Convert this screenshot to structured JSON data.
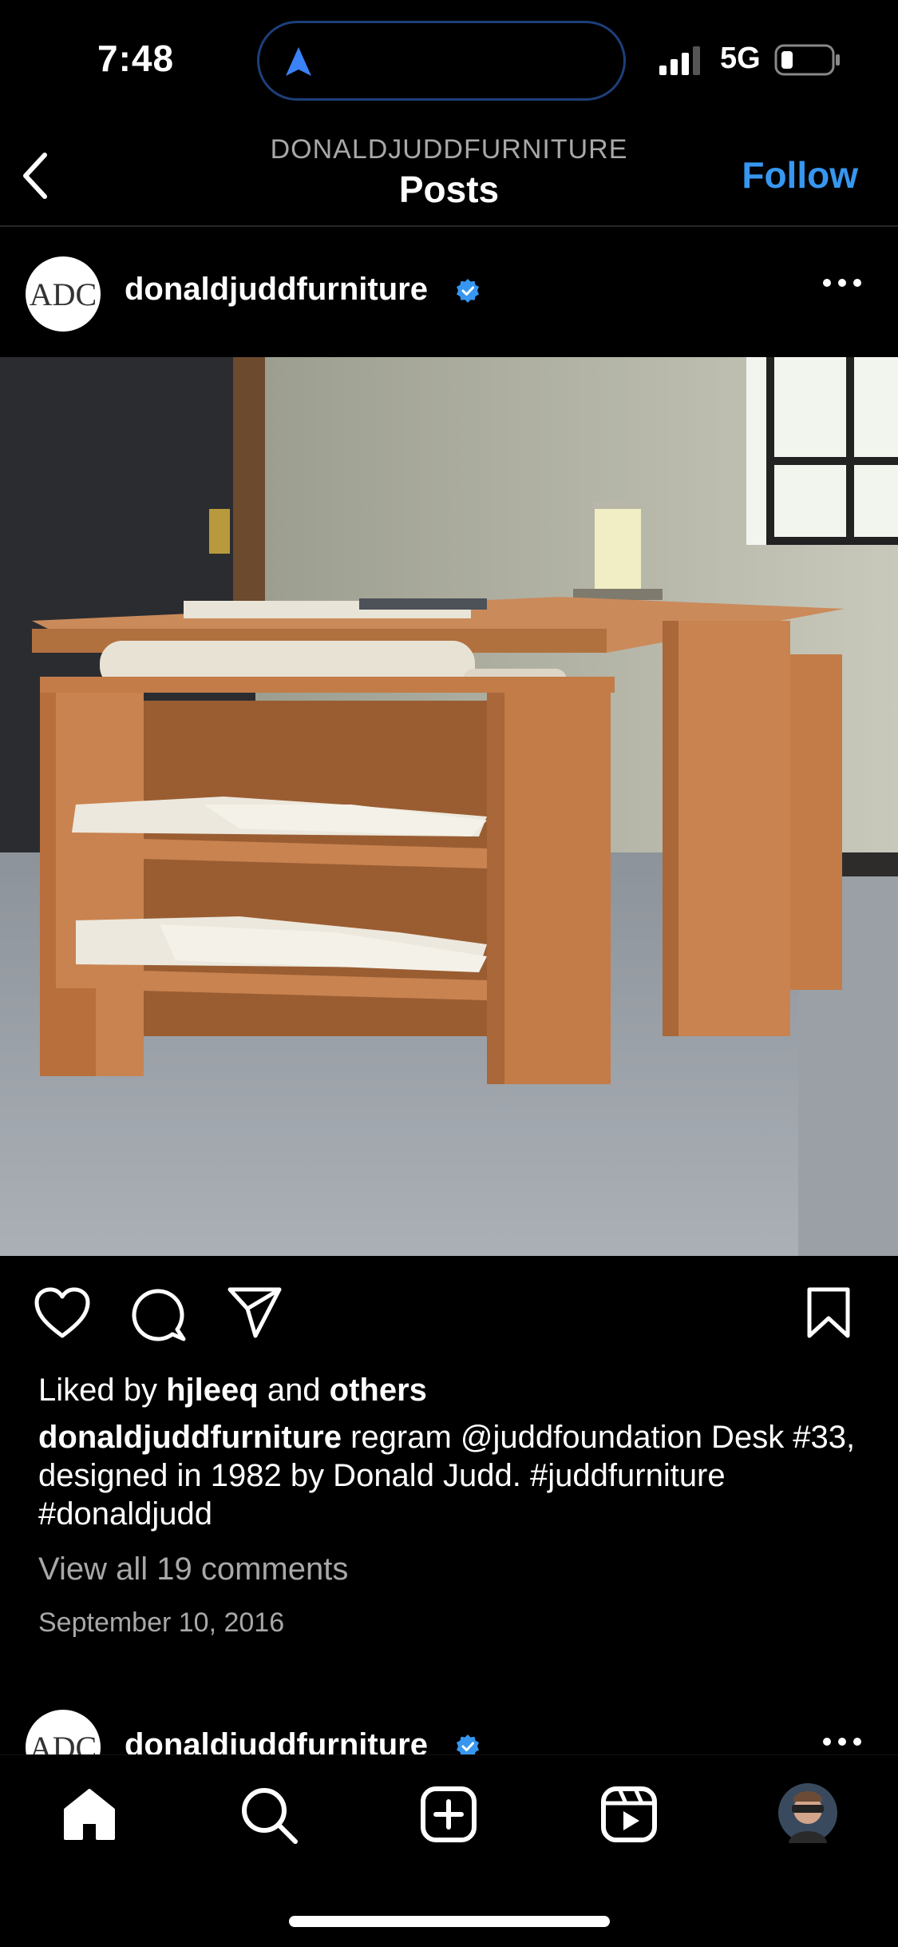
{
  "status_bar": {
    "time": "7:48",
    "network": "5G"
  },
  "header": {
    "subtitle": "DONALDJUDDFURNITURE",
    "title": "Posts",
    "follow_label": "Follow"
  },
  "post": {
    "username": "donaldjuddfurniture",
    "avatar_text": "ADC",
    "liked_by_prefix": "Liked by ",
    "liked_by_user": "hjleeq",
    "liked_by_mid": " and ",
    "liked_by_suffix": "others",
    "caption_user": "donaldjuddfurniture",
    "caption_text": " regram @juddfoundation Desk #33, designed in 1982 by Donald Judd. #juddfurniture #donaldjudd",
    "view_comments": "View all 19 comments",
    "date": "September 10, 2016"
  },
  "next_post": {
    "username": "donaldjuddfurniture",
    "avatar_text": "ADC"
  },
  "colors": {
    "accent": "#3797f0",
    "secondary_text": "#a8a8a8",
    "background": "#000000"
  },
  "icons": [
    "location-arrow-icon",
    "signal-icon",
    "battery-icon",
    "back-chevron-icon",
    "verified-badge-icon",
    "more-icon",
    "heart-icon",
    "comment-icon",
    "share-icon",
    "bookmark-icon",
    "home-icon",
    "search-icon",
    "create-icon",
    "reels-icon",
    "profile-avatar"
  ]
}
